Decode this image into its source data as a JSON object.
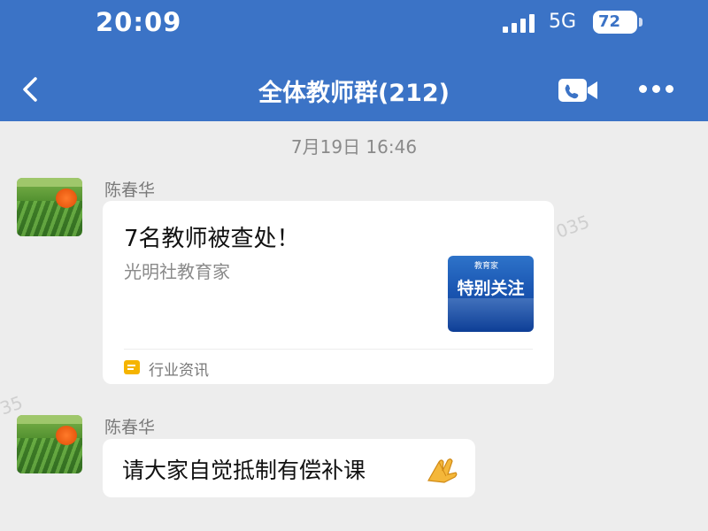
{
  "status_bar": {
    "time": "20:09",
    "network": "5G",
    "battery": "72"
  },
  "header": {
    "title": "全体教师群(212)"
  },
  "chat": {
    "timestamp": "7月19日 16:46",
    "messages": [
      {
        "sender": "陈春华",
        "type": "article",
        "title": "7名教师被查处！",
        "source": "光明社教育家",
        "thumbnail_text": "特别关注",
        "thumbnail_logo": "教育家",
        "category": "行业资讯"
      },
      {
        "sender": "陈春华",
        "type": "text",
        "text": "请大家自觉抵制有偿补课"
      }
    ]
  },
  "watermarks": [
    "035",
    "35"
  ],
  "colors": {
    "header_bg": "#3b73c6",
    "background": "#ededed",
    "category_icon": "#f5b400"
  },
  "icons": [
    "back-icon",
    "video-call-icon",
    "more-icon",
    "signal-icon",
    "battery-icon",
    "article-category-icon",
    "folded-hands-icon"
  ]
}
